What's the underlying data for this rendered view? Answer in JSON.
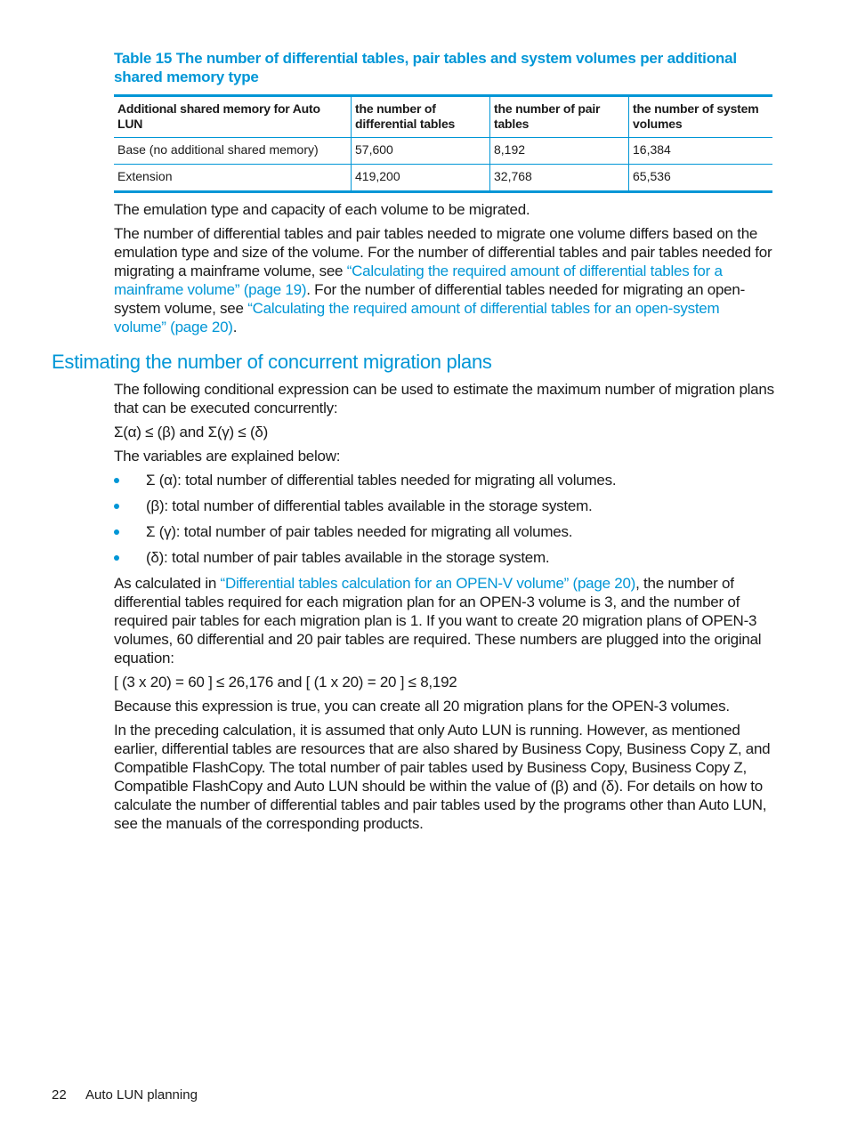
{
  "table": {
    "caption": "Table 15 The number of differential tables, pair tables and system volumes per additional shared memory type",
    "headers": [
      "Additional shared memory for Auto LUN",
      "the number of differential tables",
      "the number of pair tables",
      "the number of system volumes"
    ],
    "rows": [
      [
        "Base (no additional shared memory)",
        "57,600",
        "8,192",
        "16,384"
      ],
      [
        "Extension",
        "419,200",
        "32,768",
        "65,536"
      ]
    ]
  },
  "intro": {
    "p1": "The emulation type and capacity of each volume to be migrated.",
    "p2_a": "The number of differential tables and pair tables needed to migrate one volume differs based on the emulation type and size of the volume. For the number of differential tables and pair tables needed for migrating a mainframe volume, see ",
    "p2_link1": "“Calculating the required amount of differential tables for a mainframe volume” (page 19)",
    "p2_b": ". For the number of differential tables needed for migrating an open-system volume, see ",
    "p2_link2": "“Calculating the required amount of differential tables for an open-system volume” (page 20)",
    "p2_c": "."
  },
  "section": {
    "heading": "Estimating the number of concurrent migration plans",
    "p1": "The following conditional expression can be used to estimate the maximum number of migration plans that can be executed concurrently:",
    "expression": "Σ(α) ≤ (β) and Σ(γ) ≤ (δ)",
    "p2": "The variables are explained below:",
    "bullets": [
      "Σ (α): total number of differential tables needed for migrating all volumes.",
      "(β): total number of differential tables available in the storage system.",
      "Σ (γ): total number of pair tables needed for migrating all volumes.",
      "(δ): total number of pair tables available in the storage system."
    ],
    "p3_a": "As calculated in ",
    "p3_link": "“Differential tables calculation for an OPEN-V volume” (page 20)",
    "p3_b": ", the number of differential tables required for each migration plan for an OPEN-3 volume is 3, and the number of required pair tables for each migration plan is 1. If you want to create 20 migration plans of OPEN-3 volumes, 60 differential and 20 pair tables are required. These numbers are plugged into the original equation:",
    "equation": "[ (3 x 20) = 60 ] ≤ 26,176 and [ (1 x 20) = 20 ] ≤ 8,192",
    "p4": "Because this expression is true, you can create all 20 migration plans for the OPEN-3 volumes.",
    "p5": "In the preceding calculation, it is assumed that only Auto LUN is running. However, as mentioned earlier, differential tables are resources that are also shared by Business Copy, Business Copy Z, and Compatible FlashCopy. The total number of pair tables used by Business Copy, Business Copy Z, Compatible FlashCopy and Auto LUN should be within the value of (β) and (δ). For details on how to calculate the number of differential tables and pair tables used by the programs other than Auto LUN, see the manuals of the corresponding products."
  },
  "footer": {
    "page_number": "22",
    "chapter": "Auto LUN planning"
  }
}
